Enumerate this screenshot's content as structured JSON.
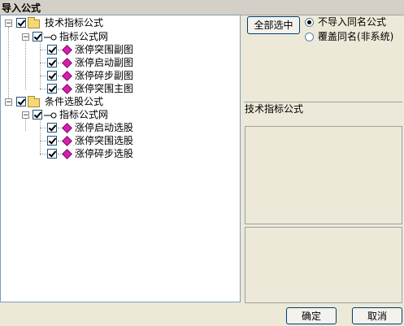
{
  "window": {
    "title": "导入公式"
  },
  "tree": {
    "groups": [
      {
        "label": "技术指标公式",
        "subgroup": "指标公式网",
        "items": [
          "涨停突围副图",
          "涨停启动副图",
          "涨停碎步副图",
          "涨停突围主图"
        ]
      },
      {
        "label": "条件选股公式",
        "subgroup": "指标公式网",
        "items": [
          "涨停启动选股",
          "涨停突围选股",
          "涨停碎步选股"
        ]
      }
    ]
  },
  "options": {
    "select_all": "全部选中",
    "radio_no_import": "不导入同名公式",
    "radio_overwrite": "覆盖同名(非系统)"
  },
  "detail": {
    "title": "技术指标公式"
  },
  "buttons": {
    "ok": "确定",
    "cancel": "取消"
  },
  "colors": {
    "diamond": "#d61eb0",
    "folder": "#f4d77a"
  }
}
